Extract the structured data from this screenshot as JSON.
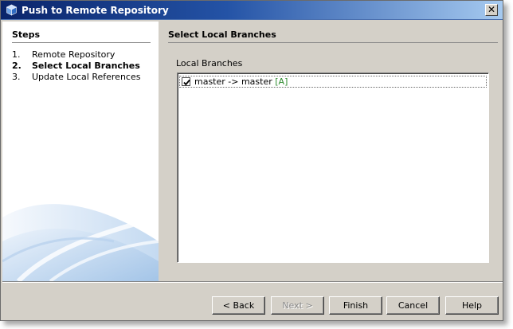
{
  "window": {
    "title": "Push to Remote Repository",
    "close_glyph": "✕",
    "title_icon": "netbeans-cube-icon",
    "colors": {
      "title_start": "#0a246a",
      "title_end": "#a6caf0",
      "face": "#d4d0c8"
    }
  },
  "steps": {
    "heading": "Steps",
    "items": [
      {
        "num": "1.",
        "label": "Remote Repository"
      },
      {
        "num": "2.",
        "label": "Select Local Branches"
      },
      {
        "num": "3.",
        "label": "Update Local References"
      }
    ],
    "current_index": 1
  },
  "main": {
    "heading": "Select Local Branches",
    "list_label": "Local Branches",
    "branches": [
      {
        "checked": true,
        "text": "master -> master ",
        "badge": "[A]",
        "badge_color": "#2e8b2e"
      }
    ]
  },
  "buttons": {
    "back": "< Back",
    "next": "Next >",
    "finish": "Finish",
    "cancel": "Cancel",
    "help": "Help"
  }
}
